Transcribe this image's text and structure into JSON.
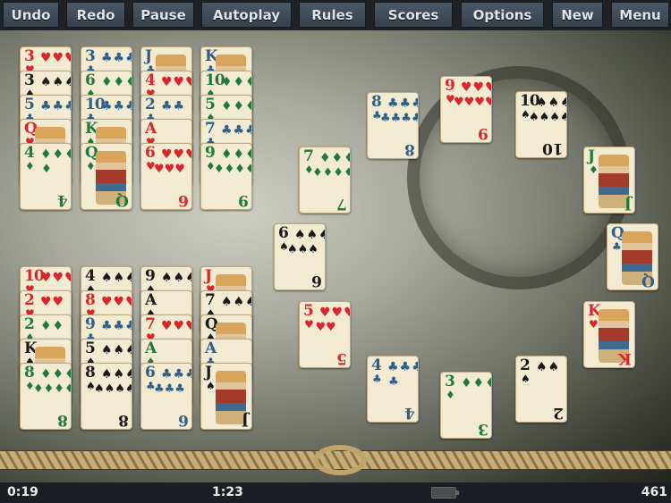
{
  "toolbar": {
    "buttons": [
      "Undo",
      "Redo",
      "Pause",
      "Autoplay",
      "Rules",
      "Scores",
      "Options",
      "New",
      "Menu"
    ]
  },
  "status": {
    "elapsed": "0:19",
    "clock": "1:23",
    "score": "461",
    "battery_icon": "battery-icon"
  },
  "suit_colors": {
    "hearts": "#d8262b",
    "spades": "#1a1a1a",
    "clubs": "#2f5f86",
    "diamonds": "#1f7a3a"
  },
  "tableau_top": [
    [
      [
        "3",
        "hearts"
      ],
      [
        "3",
        "spades"
      ],
      [
        "5",
        "clubs"
      ],
      [
        "Q",
        "hearts"
      ],
      [
        "4",
        "diamonds"
      ]
    ],
    [
      [
        "3",
        "clubs"
      ],
      [
        "6",
        "diamonds"
      ],
      [
        "10",
        "clubs"
      ],
      [
        "K",
        "diamonds"
      ],
      [
        "Q",
        "diamonds"
      ]
    ],
    [
      [
        "J",
        "clubs"
      ],
      [
        "4",
        "hearts"
      ],
      [
        "2",
        "clubs"
      ],
      [
        "A",
        "hearts"
      ],
      [
        "6",
        "hearts"
      ]
    ],
    [
      [
        "K",
        "clubs"
      ],
      [
        "10",
        "diamonds"
      ],
      [
        "5",
        "diamonds"
      ],
      [
        "7",
        "clubs"
      ],
      [
        "9",
        "diamonds"
      ]
    ]
  ],
  "tableau_bottom": [
    [
      [
        "10",
        "hearts"
      ],
      [
        "2",
        "hearts"
      ],
      [
        "2",
        "diamonds"
      ],
      [
        "K",
        "spades"
      ],
      [
        "8",
        "diamonds"
      ]
    ],
    [
      [
        "4",
        "spades"
      ],
      [
        "8",
        "hearts"
      ],
      [
        "9",
        "clubs"
      ],
      [
        "5",
        "spades"
      ],
      [
        "8",
        "spades"
      ]
    ],
    [
      [
        "9",
        "spades"
      ],
      [
        "A",
        "spades"
      ],
      [
        "7",
        "hearts"
      ],
      [
        "A",
        "diamonds"
      ],
      [
        "6",
        "clubs"
      ]
    ],
    [
      [
        "J",
        "hearts"
      ],
      [
        "7",
        "spades"
      ],
      [
        "Q",
        "spades"
      ],
      [
        "A",
        "clubs"
      ],
      [
        "J",
        "spades"
      ]
    ]
  ],
  "circle": [
    [
      "8",
      "clubs"
    ],
    [
      "9",
      "hearts"
    ],
    [
      "10",
      "spades"
    ],
    [
      "J",
      "diamonds"
    ],
    [
      "Q",
      "clubs"
    ],
    [
      "K",
      "hearts"
    ],
    [
      "2",
      "spades"
    ],
    [
      "3",
      "diamonds"
    ],
    [
      "4",
      "clubs"
    ],
    [
      "5",
      "hearts"
    ],
    [
      "6",
      "spades"
    ],
    [
      "7",
      "diamonds"
    ]
  ]
}
